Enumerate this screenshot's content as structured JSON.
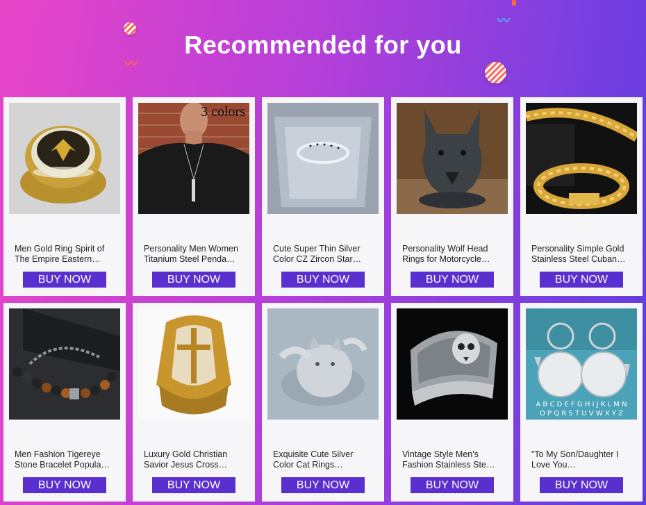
{
  "header": {
    "title": "Recommended for you"
  },
  "buy_label": "BUY NOW",
  "products": [
    {
      "line1": "Men Gold Ring Spirit of",
      "line2": "The Empire Eastern…",
      "image": "gold-eagle-ring"
    },
    {
      "line1": "Personality Men Women",
      "line2": "Titanium Steel Penda…",
      "image": "bar-pendant-necklace",
      "overlay": "3 colors"
    },
    {
      "line1": "Cute Super Thin Silver",
      "line2": "Color CZ Zircon Star…",
      "image": "thin-silver-ring"
    },
    {
      "line1": "Personality Wolf Head",
      "line2": "Rings for Motorcycle…",
      "image": "wolf-head-ring"
    },
    {
      "line1": "Personality Simple Gold",
      "line2": "Stainless Steel Cuban…",
      "image": "gold-cuban-chain"
    },
    {
      "line1": "Men Fashion Tigereye",
      "line2": "Stone Bracelet Popula…",
      "image": "tigereye-bracelet"
    },
    {
      "line1": "Luxury Gold Christian",
      "line2": "Savior Jesus Cross…",
      "image": "gold-cross-ring"
    },
    {
      "line1": "Exquisite Cute Silver",
      "line2": "Color Cat Rings…",
      "image": "silver-cat-ring"
    },
    {
      "line1": "Vintage Style Men's",
      "line2": "Fashion Stainless Ste…",
      "image": "skull-ring"
    },
    {
      "line1": "\"To My Son/Daughter I",
      "line2": "Love You…",
      "image": "letter-keychains",
      "overlay_letters": [
        "A B C D E F G H I J K L M N",
        "O P Q R S T U V W X Y Z"
      ]
    }
  ]
}
